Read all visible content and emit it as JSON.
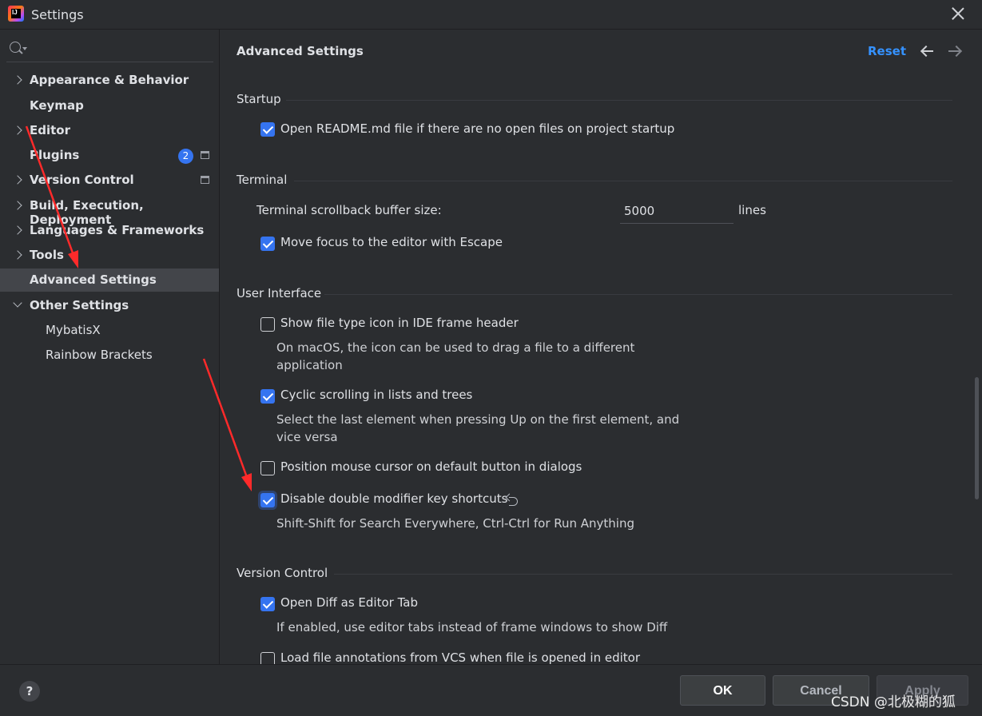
{
  "window": {
    "title": "Settings"
  },
  "sidebar": {
    "search_placeholder": "",
    "items": [
      {
        "label": "Appearance & Behavior",
        "expand": "collapsed"
      },
      {
        "label": "Keymap"
      },
      {
        "label": "Editor",
        "expand": "collapsed"
      },
      {
        "label": "Plugins",
        "badge": "2"
      },
      {
        "label": "Version Control",
        "expand": "collapsed"
      },
      {
        "label": "Build, Execution, Deployment",
        "expand": "collapsed"
      },
      {
        "label": "Languages & Frameworks",
        "expand": "collapsed"
      },
      {
        "label": "Tools",
        "expand": "collapsed"
      },
      {
        "label": "Advanced Settings",
        "selected": true
      },
      {
        "label": "Other Settings",
        "expand": "expanded"
      },
      {
        "label": "MybatisX",
        "level": 2
      },
      {
        "label": "Rainbow Brackets",
        "level": 2
      }
    ]
  },
  "header": {
    "title": "Advanced Settings",
    "reset_label": "Reset"
  },
  "sections": {
    "startup": {
      "title": "Startup",
      "open_readme": {
        "label": "Open README.md file if there are no open files on project startup",
        "checked": true
      }
    },
    "terminal": {
      "title": "Terminal",
      "buffer_label": "Terminal scrollback buffer size:",
      "buffer_value": "5000",
      "buffer_unit": "lines",
      "move_focus": {
        "label": "Move focus to the editor with Escape",
        "checked": true
      }
    },
    "ui": {
      "title": "User Interface",
      "file_type_icon": {
        "label": "Show file type icon in IDE frame header",
        "checked": false,
        "desc_line1": "On macOS, the icon can be used to drag a file to a different",
        "desc_line2": "application"
      },
      "cyclic_scrolling": {
        "label": "Cyclic scrolling in lists and trees",
        "checked": true,
        "desc_line1": "Select the last element when pressing Up on the first element, and",
        "desc_line2": "vice versa"
      },
      "position_mouse": {
        "label": "Position mouse cursor on default button in dialogs",
        "checked": false
      },
      "disable_double_modifier": {
        "label": "Disable double modifier key shortcuts",
        "checked": true,
        "desc": "Shift-Shift for Search Everywhere, Ctrl-Ctrl for Run Anything"
      }
    },
    "vcs": {
      "title": "Version Control",
      "open_diff": {
        "label": "Open Diff as Editor Tab",
        "checked": true,
        "desc": "If enabled, use editor tabs instead of frame windows to show Diff"
      },
      "load_annotations": {
        "label": "Load file annotations from VCS when file is opened in editor",
        "checked": false
      }
    }
  },
  "footer": {
    "help_label": "?",
    "ok_label": "OK",
    "cancel_label": "Cancel",
    "apply_label": "Apply"
  },
  "watermark": "CSDN @北极糊的狐",
  "colors": {
    "accent": "#3574f0",
    "link": "#3592ff",
    "background": "#2b2d30",
    "annotation": "#ff2a2a"
  }
}
